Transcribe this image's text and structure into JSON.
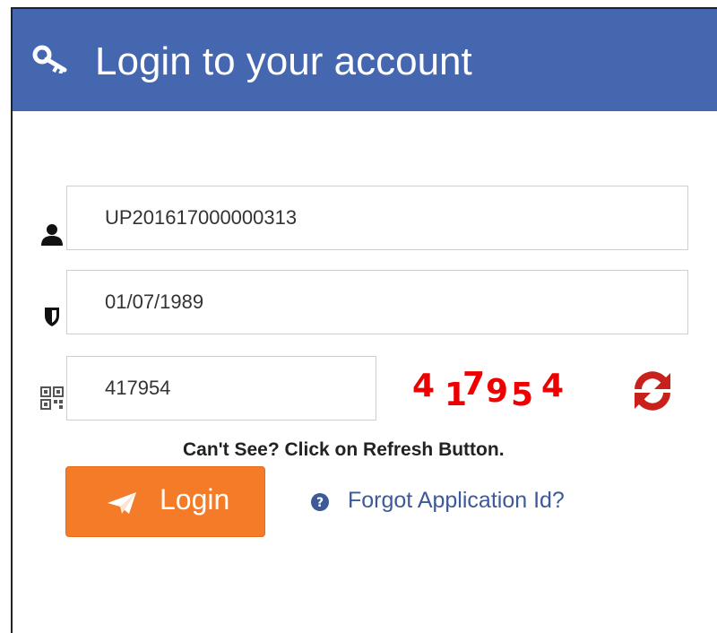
{
  "header": {
    "title": "Login to your account",
    "icon": "key-icon",
    "color": "#4567b0"
  },
  "form": {
    "application_id": {
      "value": "UP201617000000313",
      "icon": "user-icon"
    },
    "date_of_birth": {
      "value": "01/07/1989",
      "icon": "shield-icon"
    },
    "captcha_input": {
      "value": "417954",
      "icon": "qrcode-icon"
    },
    "captcha_digits": [
      "4",
      "1",
      "7",
      "9",
      "5",
      "4"
    ],
    "captcha_color": "#ee0000",
    "refresh_icon": "refresh-icon",
    "hint": "Can't See? Click on Refresh Button.",
    "login_label": "Login",
    "login_icon": "paper-plane-icon",
    "login_color": "#f47b28",
    "forgot_label": "Forgot Application Id?",
    "forgot_icon": "question-circle-icon"
  }
}
